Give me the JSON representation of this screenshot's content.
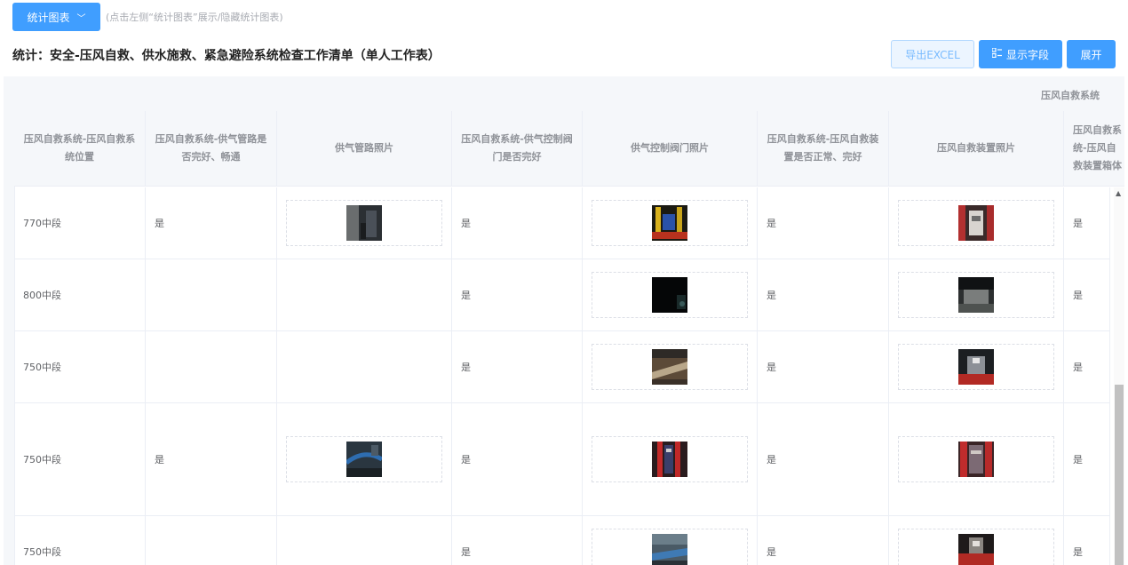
{
  "toolbar": {
    "chart_toggle_label": "统计图表",
    "hint": "(点击左侧“统计图表”展示/隐藏统计图表)",
    "export_label": "导出EXCEL",
    "fields_label": "显示字段",
    "expand_label": "展开"
  },
  "page_title": "统计：安全-压风自救、供水施救、紧急避险系统检查工作清单（单人工作表）",
  "table": {
    "group_header": "压风自救系统",
    "columns": [
      "压风自救系统-压风自救系统位置",
      "压风自救系统-供气管路是否完好、畅通",
      "供气管路照片",
      "压风自救系统-供气控制阀门是否完好",
      "供气控制阀门照片",
      "压风自救系统-压风自救装置是否正常、完好",
      "压风自救装置照片",
      "压风自救系统-压风自救装置箱体"
    ],
    "rows": [
      {
        "location": "770中段",
        "pipe_ok": "是",
        "valve_ok": "是",
        "device_ok": "是",
        "box_ok": "是"
      },
      {
        "location": "800中段",
        "pipe_ok": "",
        "valve_ok": "是",
        "device_ok": "是",
        "box_ok": "是"
      },
      {
        "location": "750中段",
        "pipe_ok": "",
        "valve_ok": "是",
        "device_ok": "是",
        "box_ok": "是"
      },
      {
        "location": "750中段",
        "pipe_ok": "是",
        "valve_ok": "是",
        "device_ok": "是",
        "box_ok": "是"
      },
      {
        "location": "750中段",
        "pipe_ok": "",
        "valve_ok": "是",
        "device_ok": "是",
        "box_ok": "是"
      }
    ]
  }
}
